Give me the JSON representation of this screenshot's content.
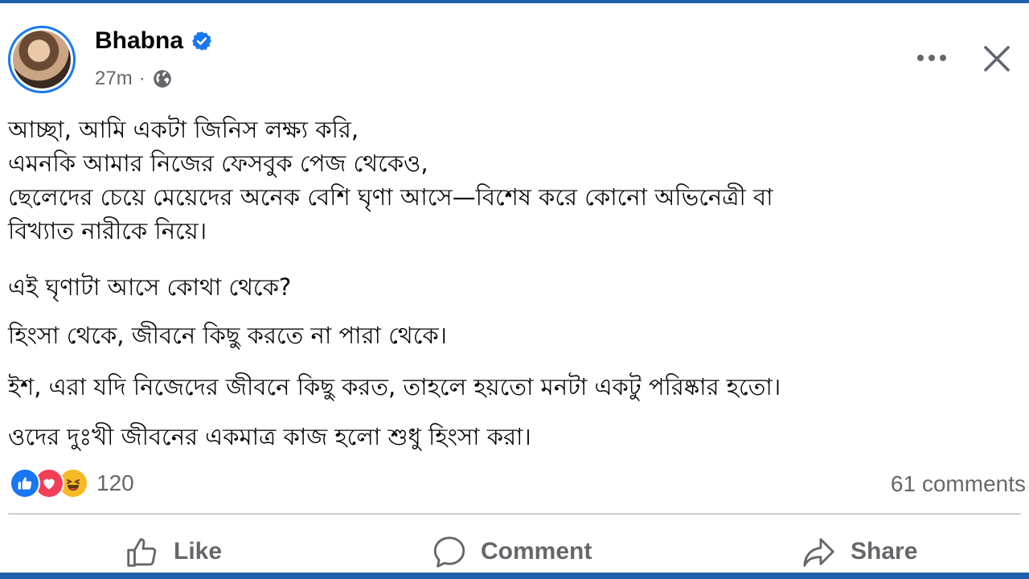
{
  "post": {
    "author": "Bhabna",
    "time": "27m",
    "separator": "·",
    "paragraphs": [
      [
        "আচ্ছা, আমি একটা জিনিস লক্ষ্য করি,",
        "এমনকি আমার নিজের ফেসবুক পেজ থেকেও,",
        "ছেলেদের চেয়ে মেয়েদের অনেক বেশি ঘৃণা আসে—বিশেষ করে কোনো অভিনেত্রী বা",
        "বিখ্যাত নারীকে নিয়ে।"
      ],
      "এই ঘৃণাটা আসে কোথা থেকে?",
      "হিংসা থেকে, জীবনে কিছু করতে না পারা থেকে।",
      "ইশ, এরা যদি নিজেদের জীবনে কিছু করত, তাহলে হয়তো মনটা একটু পরিষ্কার হতো।",
      "ওদের দুঃখী জীবনের একমাত্র কাজ হলো শুধু হিংসা করা।"
    ]
  },
  "stats": {
    "reactions_count": "120",
    "comments": "61 comments"
  },
  "actions": {
    "like": "Like",
    "comment": "Comment",
    "share": "Share"
  },
  "colors": {
    "accent": "#1877f2",
    "secondary_text": "#65676b",
    "border": "#1d5fa8"
  },
  "icons": [
    "verified-badge-icon",
    "globe-icon",
    "more-options-icon",
    "close-icon",
    "like-reaction-icon",
    "love-reaction-icon",
    "haha-reaction-icon",
    "like-icon",
    "comment-icon",
    "share-icon"
  ]
}
